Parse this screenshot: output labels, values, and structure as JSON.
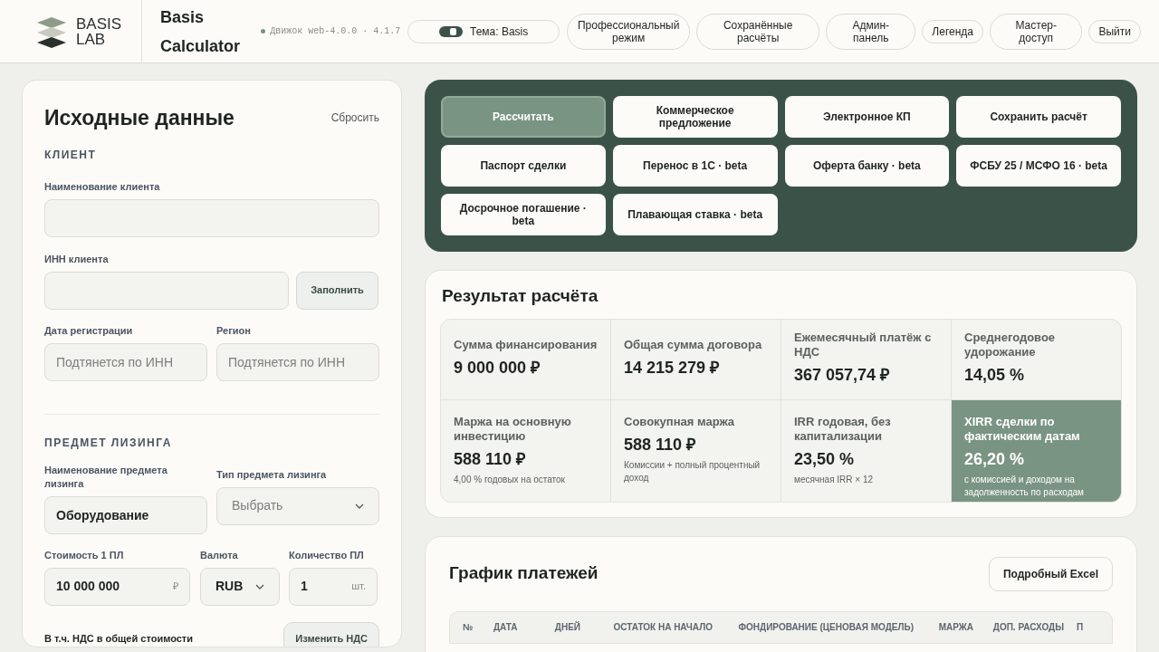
{
  "header": {
    "logo": [
      "BASIS",
      "LAB"
    ],
    "title": [
      "Basis",
      "Calculator"
    ],
    "engine": "Движок web-4.0.0 · 4.1.7",
    "theme": {
      "label": "Тема: Basis",
      "on": true
    },
    "nav": [
      {
        "label": "Профессиональный режим"
      },
      {
        "label": "Сохранённые расчёты"
      },
      {
        "label": "Админ-панель"
      },
      {
        "label": "Легенда"
      },
      {
        "label": "Мастер-доступ"
      },
      {
        "label": "Выйти"
      }
    ]
  },
  "input_panel": {
    "title": "Исходные данные",
    "reset": "Сбросить",
    "client": {
      "heading": "КЛИЕНТ",
      "name_label": "Наименование клиента",
      "inn_label": "ИНН клиента",
      "fill_button": "Заполнить",
      "date_label": "Дата регистрации",
      "date_placeholder": "Подтянется по ИНН",
      "region_label": "Регион",
      "region_placeholder": "Подтянется по ИНН"
    },
    "subject": {
      "heading": "ПРЕДМЕТ ЛИЗИНГА",
      "name_label": "Наименование предмета лизинга",
      "name_value": "Оборудование",
      "type_label": "Тип предмета лизинга",
      "type_placeholder": "Выбрать",
      "cost_label": "Стоимость 1 ПЛ",
      "cost_value": "10 000 000",
      "cost_unit": "₽",
      "currency_label": "Валюта",
      "currency_value": "RUB",
      "qty_label": "Количество ПЛ",
      "qty_value": "1",
      "qty_unit": "шт.",
      "vat_label": "В т.ч. НДС в общей стоимости",
      "vat_button": "Изменить НДС"
    }
  },
  "actions": [
    {
      "label": "Рассчитать",
      "primary": true
    },
    {
      "label": "Коммерческое предложение",
      "primary": false
    },
    {
      "label": "Электронное КП",
      "primary": false
    },
    {
      "label": "Сохранить расчёт",
      "primary": false
    },
    {
      "label": "Паспорт сделки",
      "primary": false
    },
    {
      "label": "Перенос в 1С · beta",
      "primary": false
    },
    {
      "label": "Оферта банку · beta",
      "primary": false
    },
    {
      "label": "ФСБУ 25 / МСФО 16 · beta",
      "primary": false
    },
    {
      "label": "Досрочное погашение · beta",
      "primary": false
    },
    {
      "label": "Плавающая ставка · beta",
      "primary": false
    }
  ],
  "result": {
    "title": "Результат расчёта",
    "metrics": [
      {
        "label": "Сумма финансирования",
        "value": "9 000 000 ₽",
        "highlighted": false
      },
      {
        "label": "Общая сумма договора",
        "value": "14 215 279 ₽",
        "highlighted": false
      },
      {
        "label": "Ежемесячный платёж с НДС",
        "value": "367 057,74 ₽",
        "highlighted": false
      },
      {
        "label": "Среднегодовое удорожание",
        "value": "14,05 %",
        "highlighted": false
      },
      {
        "label": "Маржа на основную инвестицию",
        "value": "588 110 ₽",
        "note": "4,00 % годовых на остаток",
        "highlighted": false
      },
      {
        "label": "Совокупная маржа",
        "value": "588 110 ₽",
        "note": "Комиссии + полный процентный доход",
        "highlighted": false
      },
      {
        "label": "IRR годовая, без капитализации",
        "value": "23,50 %",
        "note": "месячная IRR × 12",
        "highlighted": false
      },
      {
        "label": "XIRR сделки по фактическим датам",
        "value": "26,20 %",
        "note": "с комиссией и доходом на задолженность по расходам",
        "highlighted": true
      }
    ]
  },
  "schedule": {
    "title": "График платежей",
    "excel_button": "Подробный Excel",
    "columns": [
      "№",
      "ДАТА",
      "ДНЕЙ",
      "ОСТАТОК НА НАЧАЛО",
      "ФОНДИРОВАНИЕ (ЦЕНОВАЯ МОДЕЛЬ)",
      "МАРЖА",
      "ДОП. РАСХОДЫ",
      "П"
    ]
  }
}
